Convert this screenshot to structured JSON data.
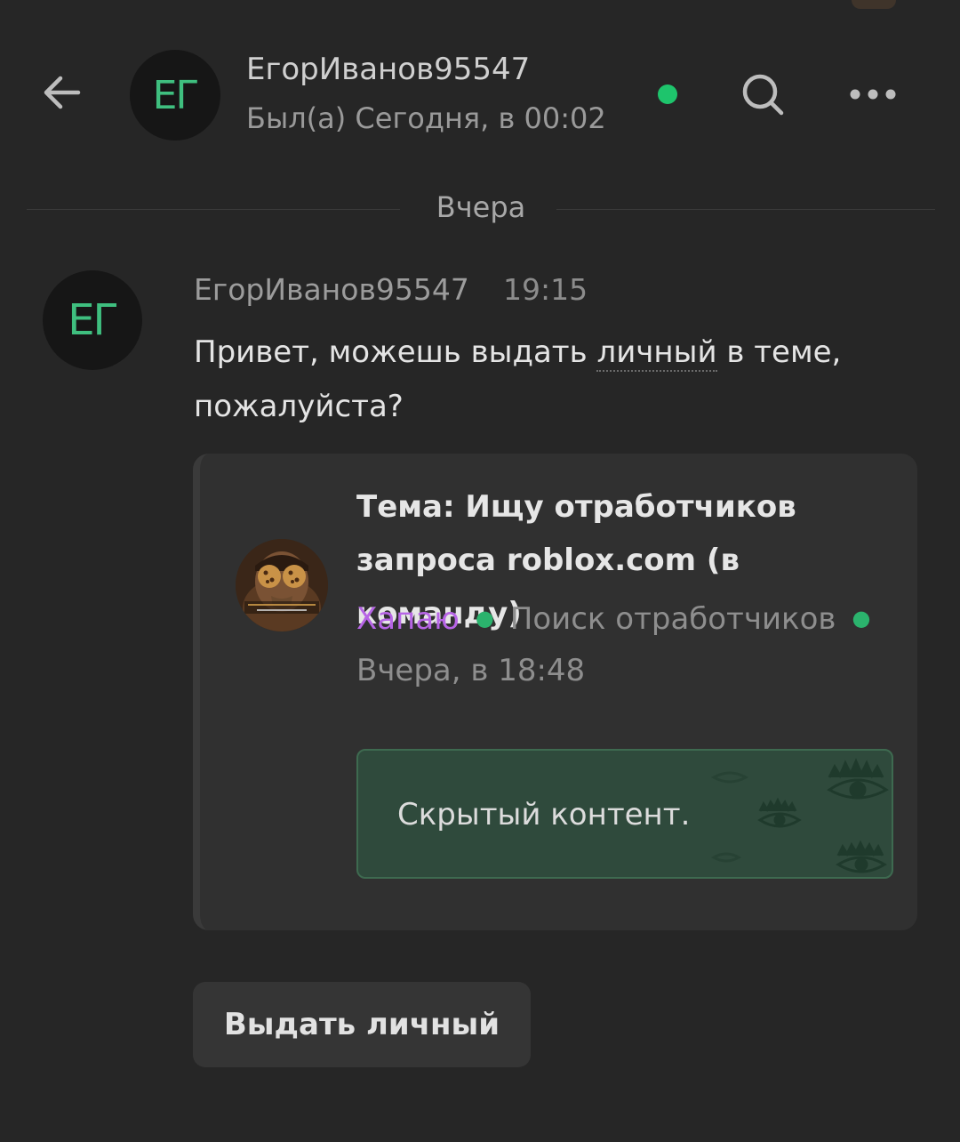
{
  "header": {
    "back_icon": "arrow-left-icon",
    "avatar_initials": "ЕГ",
    "name": "ЕгорИванов95547",
    "status": "Был(а) Сегодня, в 00:02",
    "online_color": "#1ec46c",
    "search_icon": "search-icon",
    "more_icon": "more-horizontal-icon"
  },
  "date_divider": "Вчера",
  "message": {
    "avatar_initials": "ЕГ",
    "author": "ЕгорИванов95547",
    "time": "19:15",
    "text_before": "Привет, можешь выдать ",
    "text_highlight": "личный",
    "text_after": " в теме, пожалуйста?"
  },
  "thread": {
    "avatar_icon": "cookie-avatar",
    "title": "Тема: Ищу отработчиков запроса roblox.com (в команду)",
    "author": "Хапаю",
    "category": "Поиск отработчиков",
    "date": "Вчера, в 18:48",
    "hidden_content": "Скрытый контент.",
    "author_color": "#b765e6",
    "hidden_bg": "#2f4a3c"
  },
  "action_button": "Выдать личный"
}
